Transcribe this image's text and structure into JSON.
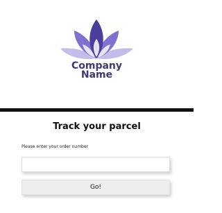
{
  "branding": {
    "company_line1": "Company",
    "company_line2": "Name",
    "logo_icon": "lotus-icon",
    "colors": {
      "dark_purple": "#4b3f9e",
      "mid_purple": "#7f72cf",
      "light_purple": "#c4bdea",
      "text": "#3f3b6e"
    }
  },
  "tracking": {
    "title": "Track your parcel",
    "field_label": "Please enter your order number",
    "order_input": {
      "value": "",
      "placeholder": ""
    },
    "submit_label": "Go!"
  }
}
